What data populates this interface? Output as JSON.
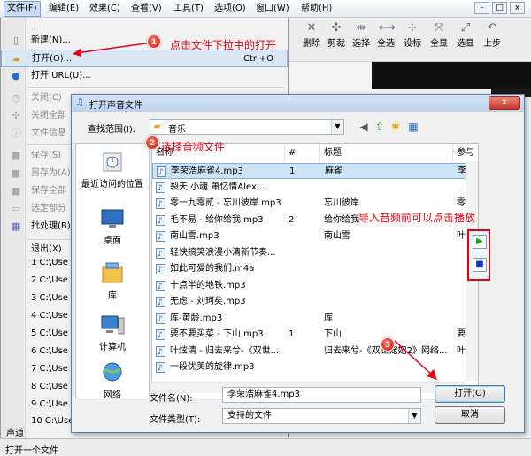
{
  "menubar": {
    "items": [
      "文件(F)",
      "编辑(E)",
      "效果(C)",
      "查看(V)",
      "工具(T)",
      "选项(O)",
      "窗口(W)",
      "帮助(H)"
    ]
  },
  "window_controls": {
    "minimize": "–",
    "restore": "□",
    "close": "x"
  },
  "toolbar": {
    "items": [
      "删除",
      "剪裁",
      "选择",
      "全选",
      "设标",
      "全显",
      "选显",
      "上步"
    ]
  },
  "file_menu": {
    "items": [
      {
        "label": "新建(N)...",
        "disabled": false,
        "icon": "new-doc-icon"
      },
      {
        "label": "打开(O)...",
        "shortcut": "Ctrl+O",
        "disabled": false,
        "icon": "open-folder-icon",
        "selected": true
      },
      {
        "label": "打开 URL(U)...",
        "disabled": false,
        "icon": "globe-icon"
      },
      {
        "label": "关闭(C)",
        "disabled": true,
        "icon": "close-doc-icon"
      },
      {
        "label": "关闭全部",
        "disabled": true,
        "icon": "close-all-icon"
      },
      {
        "label": "文件信息",
        "disabled": true,
        "icon": "info-icon"
      },
      {
        "label": "保存(S)",
        "disabled": true,
        "icon": "save-icon"
      },
      {
        "label": "另存为(A)",
        "disabled": true,
        "icon": "save-as-icon"
      },
      {
        "label": "保存全部",
        "disabled": true,
        "icon": "save-all-icon"
      },
      {
        "label": "选定部分",
        "disabled": true,
        "icon": "selection-icon"
      },
      {
        "label": "批处理(B)",
        "disabled": false,
        "icon": "batch-icon"
      },
      {
        "label": "退出(X)",
        "disabled": false,
        "icon": ""
      }
    ],
    "recent": [
      "1 C:\\Use",
      "2 C:\\Use",
      "3 C:\\Use",
      "4 C:\\Use",
      "5 C:\\Use",
      "6 C:\\Use",
      "7 C:\\Use",
      "8 C:\\Use",
      "9 C:\\Use",
      "10 C:\\Use"
    ],
    "tail": "声道"
  },
  "annotations": {
    "step1": "点击文件下拉中的打开",
    "step2": "选择音频文件",
    "step3_hint": "导入音频前可以点击播放",
    "badges": [
      "1",
      "2",
      "3"
    ]
  },
  "dialog": {
    "title": "打开声音文件",
    "close_label": "x",
    "look_in_label": "查找范围(I):",
    "look_in_value": "音乐",
    "places": [
      "最近访问的位置",
      "桌面",
      "库",
      "计算机",
      "网络"
    ],
    "columns": [
      "名称",
      "#",
      "标题",
      "参与"
    ],
    "files": [
      {
        "name": "李荣浩麻雀4.mp3",
        "num": "1",
        "title": "麻雀",
        "artist": "李荣",
        "selected": true
      },
      {
        "name": "裂天   小魂   萧忆情Alex ...",
        "num": "",
        "title": "",
        "artist": ""
      },
      {
        "name": "零一九零贰 - 忘川彼岸.mp3",
        "num": "",
        "title": "忘川彼岸",
        "artist": "零一"
      },
      {
        "name": "毛不易 - 给你给我.mp3",
        "num": "2",
        "title": "给你给我",
        "artist": ""
      },
      {
        "name": "南山雪.mp3",
        "num": "",
        "title": "南山雪",
        "artist": "叶里"
      },
      {
        "name": "轻快搞笑浪漫小清新节奏...",
        "num": "",
        "title": "",
        "artist": ""
      },
      {
        "name": "如此可爱的我们.m4a",
        "num": "",
        "title": "",
        "artist": ""
      },
      {
        "name": "十点半的地铁.mp3",
        "num": "",
        "title": "",
        "artist": ""
      },
      {
        "name": "无虑 - 刘珂矣.mp3",
        "num": "",
        "title": "",
        "artist": ""
      },
      {
        "name": "库-黄龄.mp3",
        "num": "",
        "title": "库",
        "artist": ""
      },
      {
        "name": "要不要买菜 - 下山.mp3",
        "num": "1",
        "title": "下山",
        "artist": "要不"
      },
      {
        "name": "叶炫清 - 归去来兮-《双世...",
        "num": "",
        "title": "归去来兮-《双世宠妃2》网络...",
        "artist": "叶炫"
      },
      {
        "name": "一段优美的旋律.mp3",
        "num": "",
        "title": "",
        "artist": ""
      }
    ],
    "filename_label": "文件名(N):",
    "filename_value": "李荣浩麻雀4.mp3",
    "filetype_label": "文件类型(T):",
    "filetype_value": "支持的文件",
    "open_button": "打开(O)",
    "cancel_button": "取消"
  },
  "statusbar": {
    "text": "打开一个文件"
  },
  "colors": {
    "annotation": "#e60012",
    "play": "#16a116",
    "stop": "#1136c4"
  }
}
